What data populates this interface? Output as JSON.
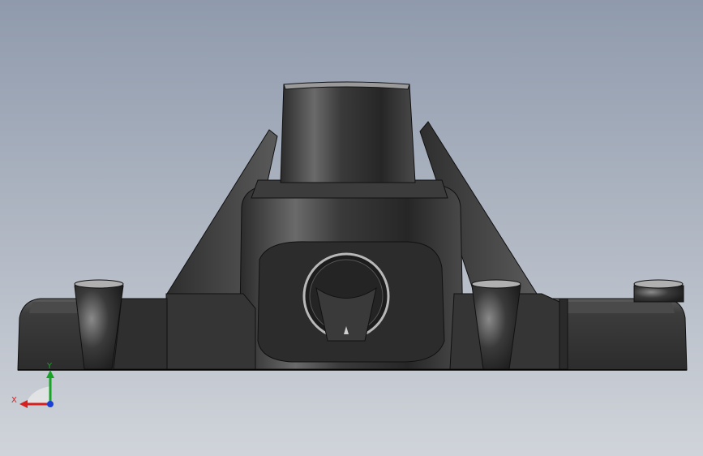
{
  "viewport": {
    "background_top": "#8f9aac",
    "background_bottom": "#cfd3da",
    "model": {
      "name": "",
      "shading": "dark-metal",
      "edge_color": "#111111"
    }
  },
  "triad": {
    "x_label": "X",
    "y_label": "Y",
    "x_color": "#d61f1f",
    "y_color": "#17a326",
    "z_color": "#1a3fd6"
  }
}
